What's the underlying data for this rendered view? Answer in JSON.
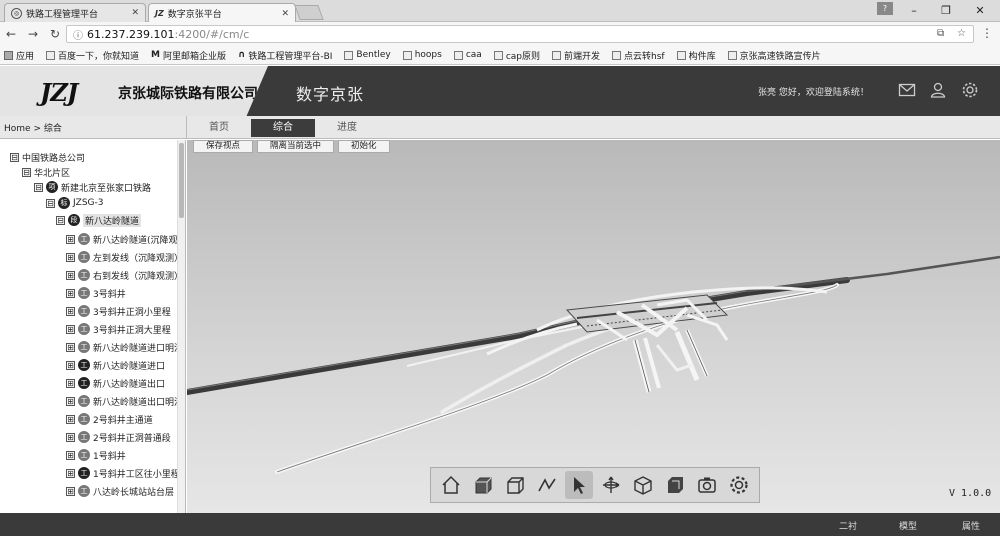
{
  "browser": {
    "tabs": [
      {
        "title": "铁路工程管理平台",
        "icon": "globe-icon"
      },
      {
        "title": "数字京张平台",
        "icon": "jz-logo-icon"
      }
    ],
    "user_badge": "?",
    "url_host": "61.237.239.101",
    "url_path": ":4200/#/cm/c",
    "bookmarks": [
      "应用",
      "百度一下，你就知道",
      "阿里邮箱企业版",
      "铁路工程管理平台-BI",
      "Bentley",
      "hoops",
      "caa",
      "cap原则",
      "前端开发",
      "点云转hsf",
      "构件库",
      "京张高速铁路宣传片"
    ]
  },
  "header": {
    "logo_text": "JZJ",
    "company": "京张城际铁路有限公司",
    "platform": "数字京张",
    "welcome": "张亮 您好，欢迎登陆系统！",
    "icons": [
      "mail-icon",
      "user-icon",
      "settings-icon"
    ]
  },
  "subnav": {
    "breadcrumb": "Home > 综合",
    "tabs": [
      "首页",
      "综合",
      "进度"
    ],
    "active_tab": "综合"
  },
  "tree": {
    "nodes": [
      {
        "label": "中国铁路总公司",
        "toggle": "⊟"
      },
      {
        "label": "华北片区",
        "toggle": "⊟"
      },
      {
        "label": "新建北京至张家口铁路",
        "toggle": "⊟",
        "badge": "项"
      },
      {
        "label": "JZSG-3",
        "toggle": "⊟",
        "badge": "标"
      },
      {
        "label": "新八达岭隧道",
        "toggle": "⊟",
        "badge": "段"
      },
      {
        "label": "新八达岭隧道(沉降观",
        "toggle": "⊞",
        "badge": "工"
      },
      {
        "label": "左到发线（沉降观测）",
        "toggle": "⊞",
        "badge": "工"
      },
      {
        "label": "右到发线（沉降观测）",
        "toggle": "⊞",
        "badge": "工"
      },
      {
        "label": "3号斜井",
        "toggle": "⊞",
        "badge": "工"
      },
      {
        "label": "3号斜井正洞小里程",
        "toggle": "⊞",
        "badge": "工"
      },
      {
        "label": "3号斜井正洞大里程",
        "toggle": "⊞",
        "badge": "工"
      },
      {
        "label": "新八达岭隧道进口明洞",
        "toggle": "⊞",
        "badge": "工"
      },
      {
        "label": "新八达岭隧道进口",
        "toggle": "⊞",
        "badge": "工"
      },
      {
        "label": "新八达岭隧道出口",
        "toggle": "⊞",
        "badge": "工"
      },
      {
        "label": "新八达岭隧道出口明洞",
        "toggle": "⊞",
        "badge": "工"
      },
      {
        "label": "2号斜井主通道",
        "toggle": "⊞",
        "badge": "工"
      },
      {
        "label": "2号斜井正洞普通段（",
        "toggle": "⊞",
        "badge": "工"
      },
      {
        "label": "1号斜井",
        "toggle": "⊞",
        "badge": "工"
      },
      {
        "label": "1号斜井工区往小里程",
        "toggle": "⊞",
        "badge": "工"
      },
      {
        "label": "八达岭长城站站台层",
        "toggle": "⊞",
        "badge": "工"
      }
    ]
  },
  "viewport": {
    "buttons": [
      "保存视点",
      "隔离当前选中",
      "初始化"
    ],
    "tools": [
      "home-icon",
      "front-view-icon",
      "iso-view-icon",
      "measure-icon",
      "select-cursor-icon",
      "rotate-icon",
      "cube-icon",
      "box-view-icon",
      "camera-icon",
      "gear-icon"
    ],
    "active_tool": "select-cursor-icon",
    "version": "V 1.0.0"
  },
  "status": {
    "items": [
      "二衬",
      "模型",
      "属性"
    ]
  }
}
